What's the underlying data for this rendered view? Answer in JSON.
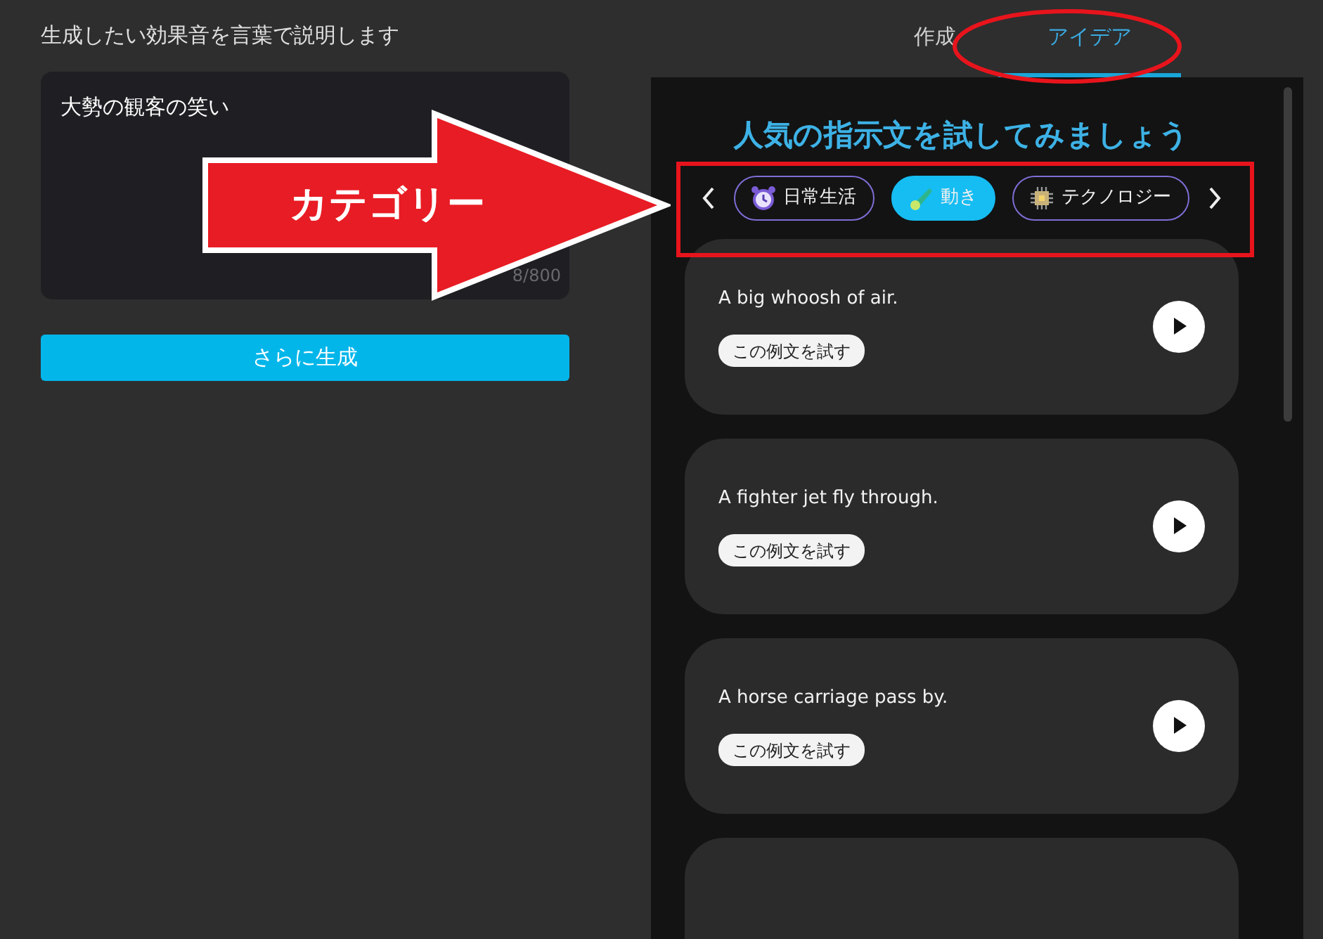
{
  "prompt_panel": {
    "label": "生成したい効果音を言葉で説明します",
    "input_value": "大勢の観客の笑い",
    "char_count": "8/800",
    "generate_button": "さらに生成"
  },
  "tabs": [
    {
      "label": "作成",
      "selected": false
    },
    {
      "label": "アイデア",
      "selected": true
    }
  ],
  "ideas": {
    "title": "人気の指示文を試してみましょう",
    "categories": [
      {
        "label": "日常生活",
        "kind": "clock",
        "selected": false
      },
      {
        "label": "動き",
        "kind": "comet",
        "selected": true
      },
      {
        "label": "テクノロジー",
        "kind": "chip",
        "selected": false
      }
    ],
    "cards": [
      {
        "text": "A big whoosh of air.",
        "try_button": "この例文を試す"
      },
      {
        "text": "A fighter jet fly through.",
        "try_button": "この例文を試す"
      },
      {
        "text": "A horse carriage pass by.",
        "try_button": "この例文を試す"
      }
    ],
    "more_cards_below": true
  },
  "annotations": {
    "arrow_label": "カテゴリー",
    "tab_circled": true,
    "categories_boxed": true
  }
}
